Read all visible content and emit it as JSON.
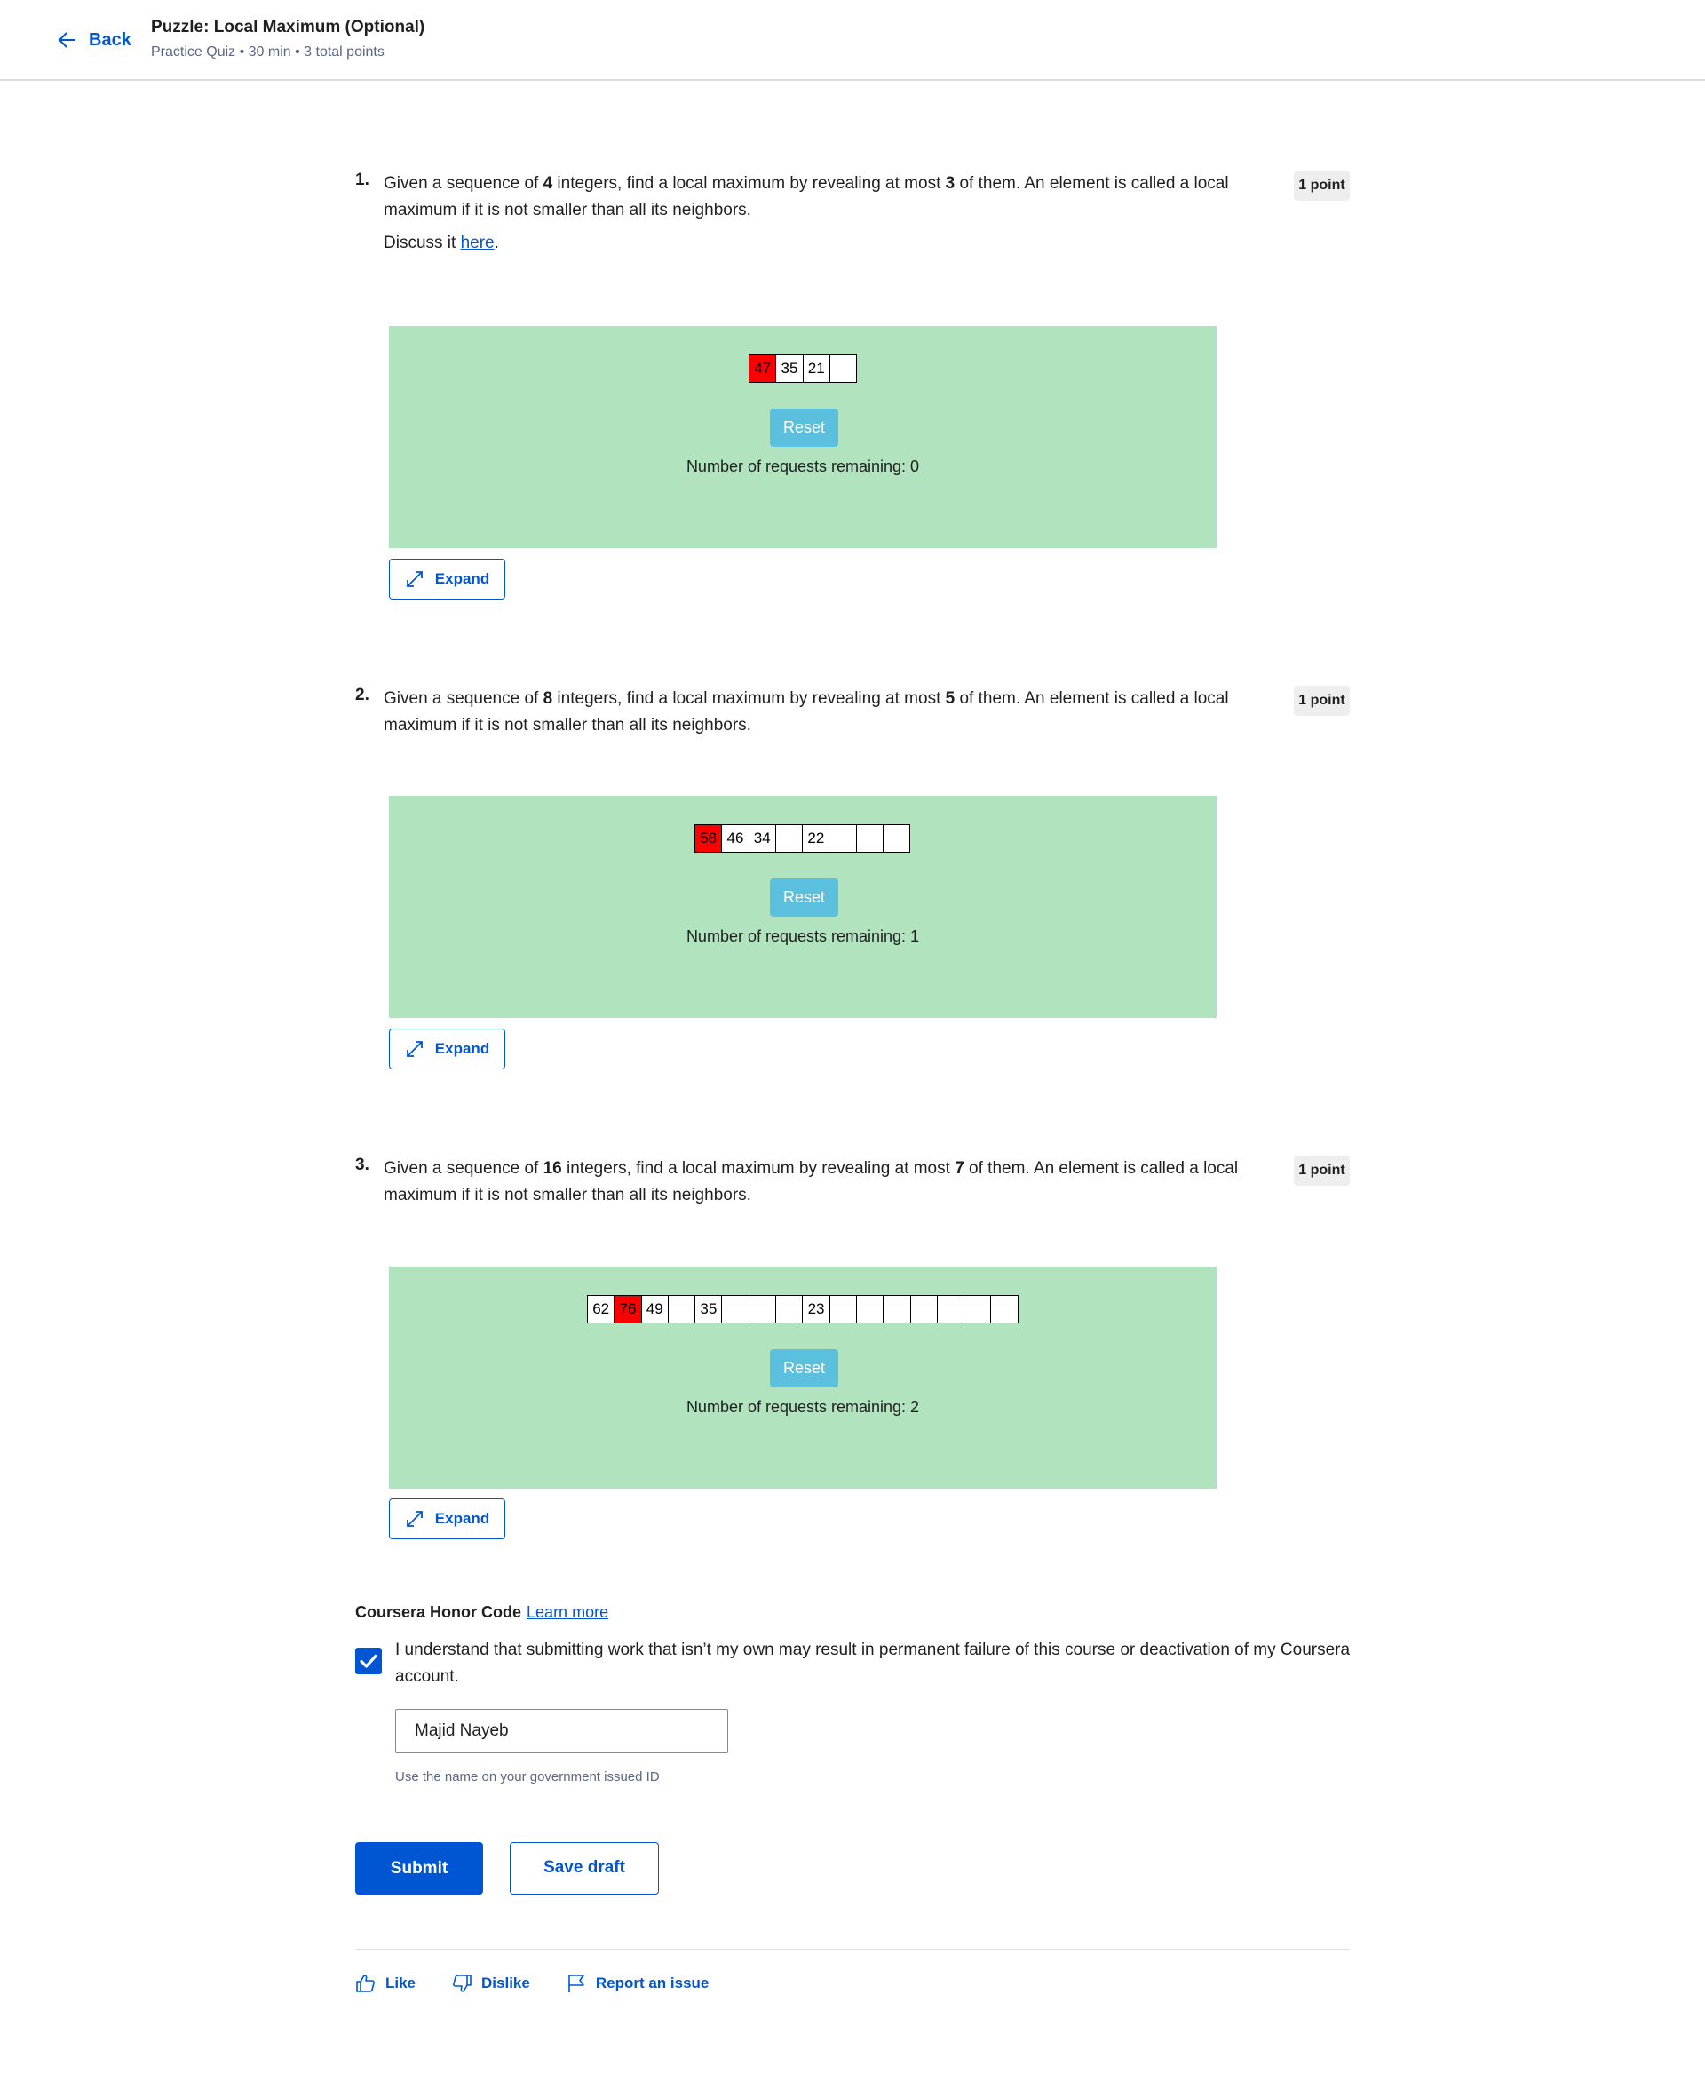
{
  "header": {
    "back_label": "Back",
    "title": "Puzzle: Local Maximum (Optional)",
    "subtitle": "Practice Quiz • 30 min • 3 total points"
  },
  "questions": [
    {
      "number": "1.",
      "text_a": "Given a sequence of ",
      "n": "4",
      "text_b": " integers, find a local maximum by revealing at most ",
      "k": "3",
      "text_c": " of them. An element is called a local maximum if it is not smaller than all its neighbors.",
      "points": "1 point",
      "discuss_prefix": "Discuss it ",
      "discuss_link": "here",
      "discuss_suffix": ".",
      "cells": [
        "47",
        "35",
        "21",
        ""
      ],
      "highlight": 0,
      "reset_label": "Reset",
      "remaining_text": "Number of requests remaining: 0",
      "expand_label": "Expand"
    },
    {
      "number": "2.",
      "text_a": "Given a sequence of ",
      "n": "8",
      "text_b": " integers, find a local maximum by revealing at most ",
      "k": "5",
      "text_c": " of them. An element is called a local maximum if it is not smaller than all its neighbors.",
      "points": "1 point",
      "cells": [
        "58",
        "46",
        "34",
        "",
        "22",
        "",
        "",
        ""
      ],
      "highlight": 0,
      "reset_label": "Reset",
      "remaining_text": "Number of requests remaining: 1",
      "expand_label": "Expand"
    },
    {
      "number": "3.",
      "text_a": "Given a sequence of ",
      "n": "16",
      "text_b": " integers, find a local maximum by revealing at most ",
      "k": "7",
      "text_c": " of them. An element is called a local maximum if it is not smaller than all its neighbors.",
      "points": "1 point",
      "cells": [
        "62",
        "76",
        "49",
        "",
        "35",
        "",
        "",
        "",
        "23",
        "",
        "",
        "",
        "",
        "",
        "",
        ""
      ],
      "highlight": 1,
      "reset_label": "Reset",
      "remaining_text": "Number of requests remaining: 2",
      "expand_label": "Expand"
    }
  ],
  "honor": {
    "title": "Coursera Honor Code",
    "learn_more": "Learn more",
    "checkbox_label": "I understand that submitting work that isn’t my own may result in permanent failure of this course or deactivation of my Coursera account.",
    "checked": true,
    "name_value": "Majid Nayeb",
    "hint": "Use the name on your government issued ID"
  },
  "actions": {
    "submit_label": "Submit",
    "save_label": "Save draft"
  },
  "footer": {
    "like_label": "Like",
    "dislike_label": "Dislike",
    "report_label": "Report an issue"
  },
  "colors": {
    "accent": "#0056d2",
    "puzzle_bg": "#b1e3bf",
    "reset_bg": "#5bc0de",
    "highlight": "#ff0000"
  }
}
